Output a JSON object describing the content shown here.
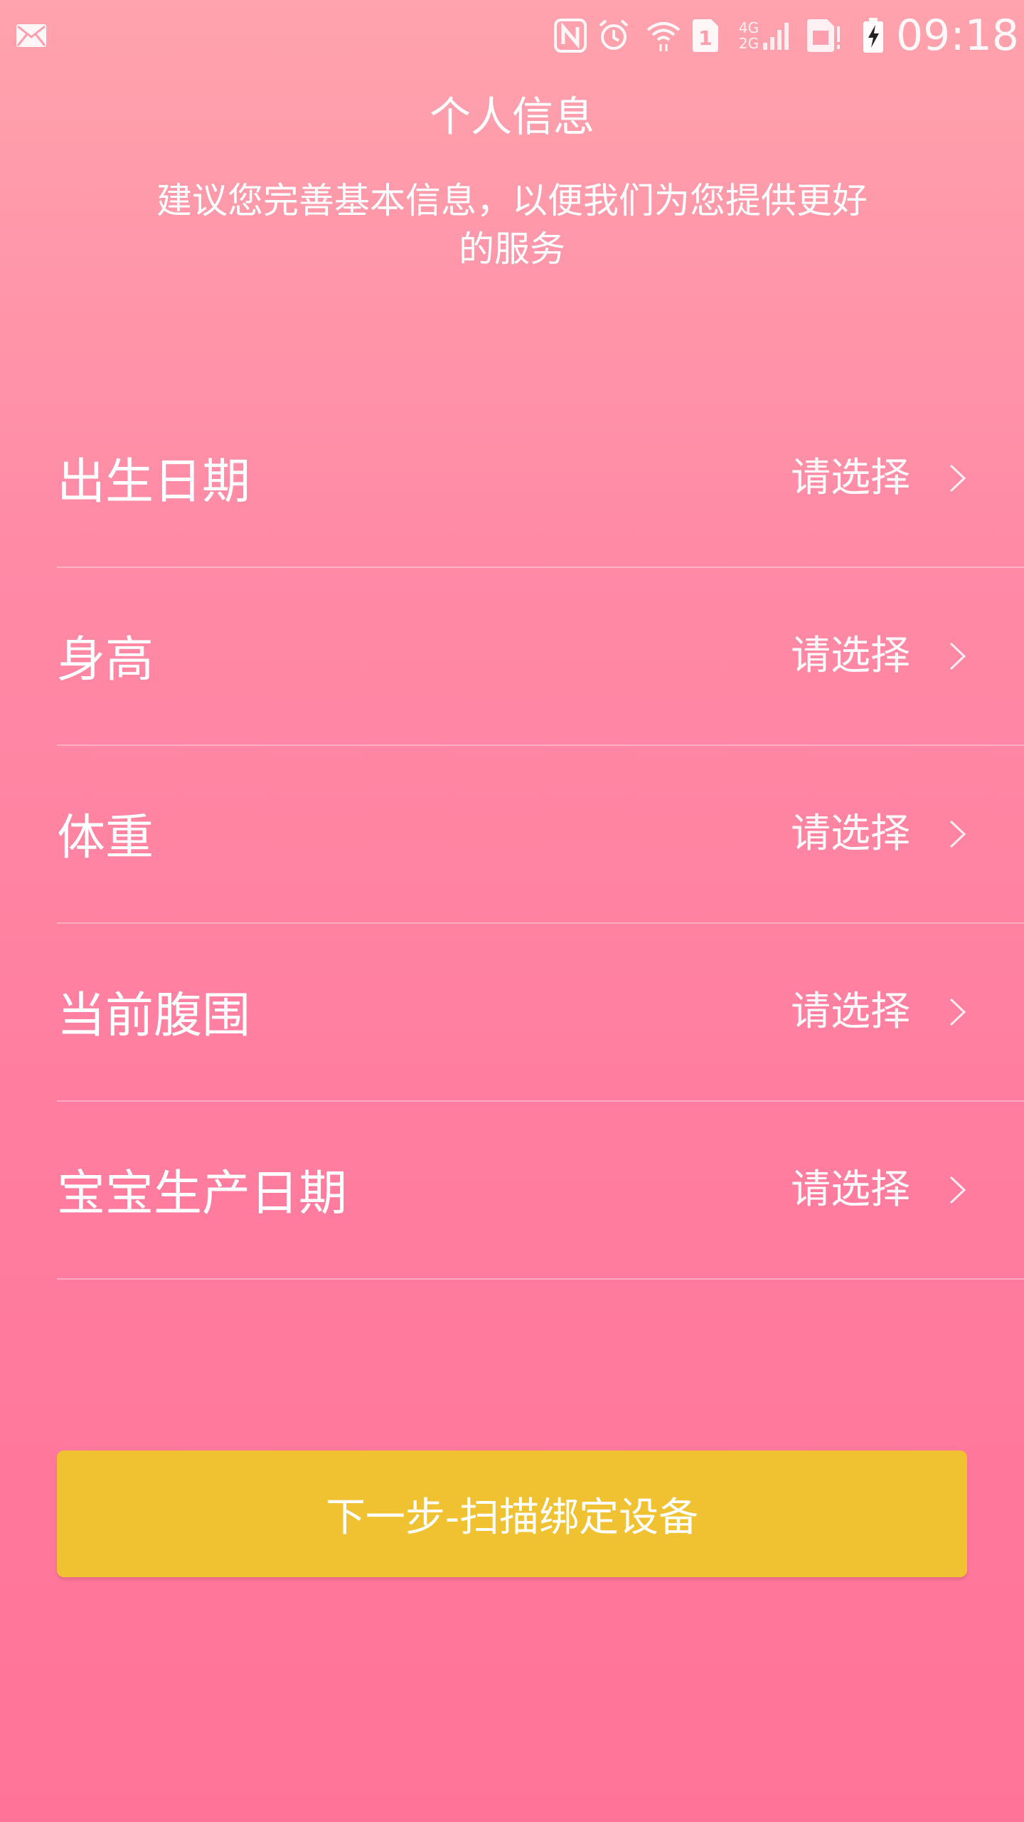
{
  "status_bar": {
    "time": "09:18",
    "sim_slot": "1",
    "network_top": "4G",
    "network_bottom": "2G",
    "icons": [
      "mail-icon",
      "nfc-icon",
      "alarm-icon",
      "wifi-icon",
      "sim-card-icon",
      "signal-icon",
      "sim-card-icon",
      "battery-charging-icon"
    ]
  },
  "header": {
    "title": "个人信息",
    "subtitle_line1": "建议您完善基本信息，以便我们为您提供更好",
    "subtitle_line2": "的服务"
  },
  "form": {
    "rows": [
      {
        "label": "出生日期",
        "value": "请选择"
      },
      {
        "label": "身高",
        "value": "请选择"
      },
      {
        "label": "体重",
        "value": "请选择"
      },
      {
        "label": "当前腹围",
        "value": "请选择"
      },
      {
        "label": "宝宝生产日期",
        "value": "请选择"
      }
    ]
  },
  "next_button": {
    "label": "下一步-扫描绑定设备"
  },
  "colors": {
    "background_top": "#ffa3ad",
    "background_bottom": "#ff7398",
    "button": "#f0c232",
    "text": "#ffffff"
  }
}
